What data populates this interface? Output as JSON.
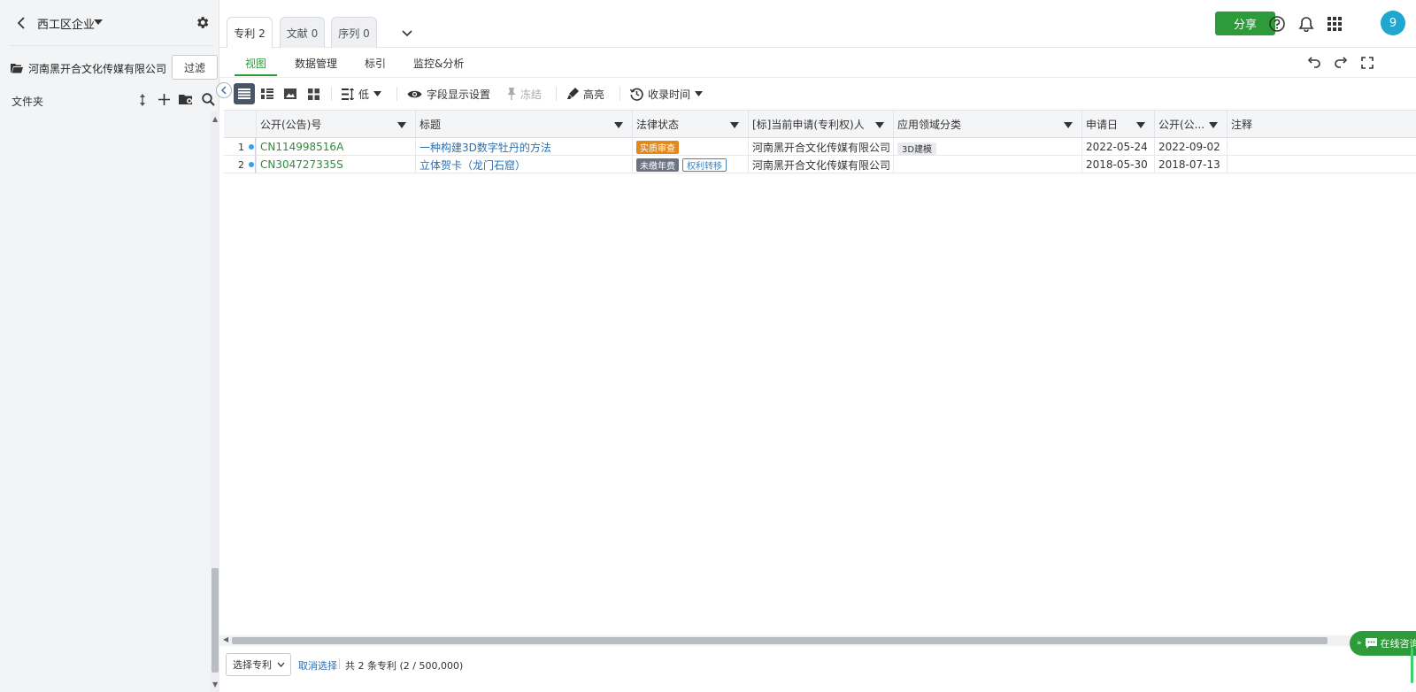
{
  "sidebar": {
    "title": "西工区企业",
    "company": "河南黑开合文化传媒有限公司",
    "filter_label": "过滤",
    "folder_label": "文件夹"
  },
  "tabs": [
    {
      "label": "专利 2",
      "active": true
    },
    {
      "label": "文献 0",
      "active": false
    },
    {
      "label": "序列 0",
      "active": false
    }
  ],
  "header": {
    "share_label": "分享",
    "avatar_text": "9"
  },
  "subnav": [
    {
      "label": "视图",
      "active": true
    },
    {
      "label": "数据管理",
      "active": false
    },
    {
      "label": "标引",
      "active": false
    },
    {
      "label": "监控&分析",
      "active": false
    }
  ],
  "toolbar": {
    "density_label": "低",
    "fields_label": "字段显示设置",
    "freeze_label": "冻结",
    "highlight_label": "高亮",
    "sort_label": "收录时间"
  },
  "table": {
    "columns": [
      "公开(公告)号",
      "标题",
      "法律状态",
      "[标]当前申请(专利权)人",
      "应用领域分类",
      "申请日",
      "公开(公...",
      "注释"
    ],
    "rows": [
      {
        "num": "1",
        "pub_no": "CN114998516A",
        "title": "一种构建3D数字牡丹的方法",
        "statuses": [
          "实质审查"
        ],
        "applicant": "河南黑开合文化传媒有限公司",
        "field": "3D建模",
        "app_date": "2022-05-24",
        "pub_date": "2022-09-02",
        "note": ""
      },
      {
        "num": "2",
        "pub_no": "CN304727335S",
        "title": "立体贺卡（龙门石窟）",
        "statuses": [
          "未缴年费",
          "权利转移"
        ],
        "applicant": "河南黑开合文化传媒有限公司",
        "field": "",
        "app_date": "2018-05-30",
        "pub_date": "2018-07-13",
        "note": ""
      }
    ]
  },
  "footer": {
    "select_label": "选择专利",
    "cancel_label": "取消选择",
    "count_text": "共 2 条专利 (2 / 500,000)"
  },
  "consult_label": "在线咨询",
  "colors": {
    "accent_green": "#2e9b3b",
    "link_blue": "#2a6fb5",
    "status_orange": "#e08a1e",
    "status_gray": "#6b7280"
  }
}
